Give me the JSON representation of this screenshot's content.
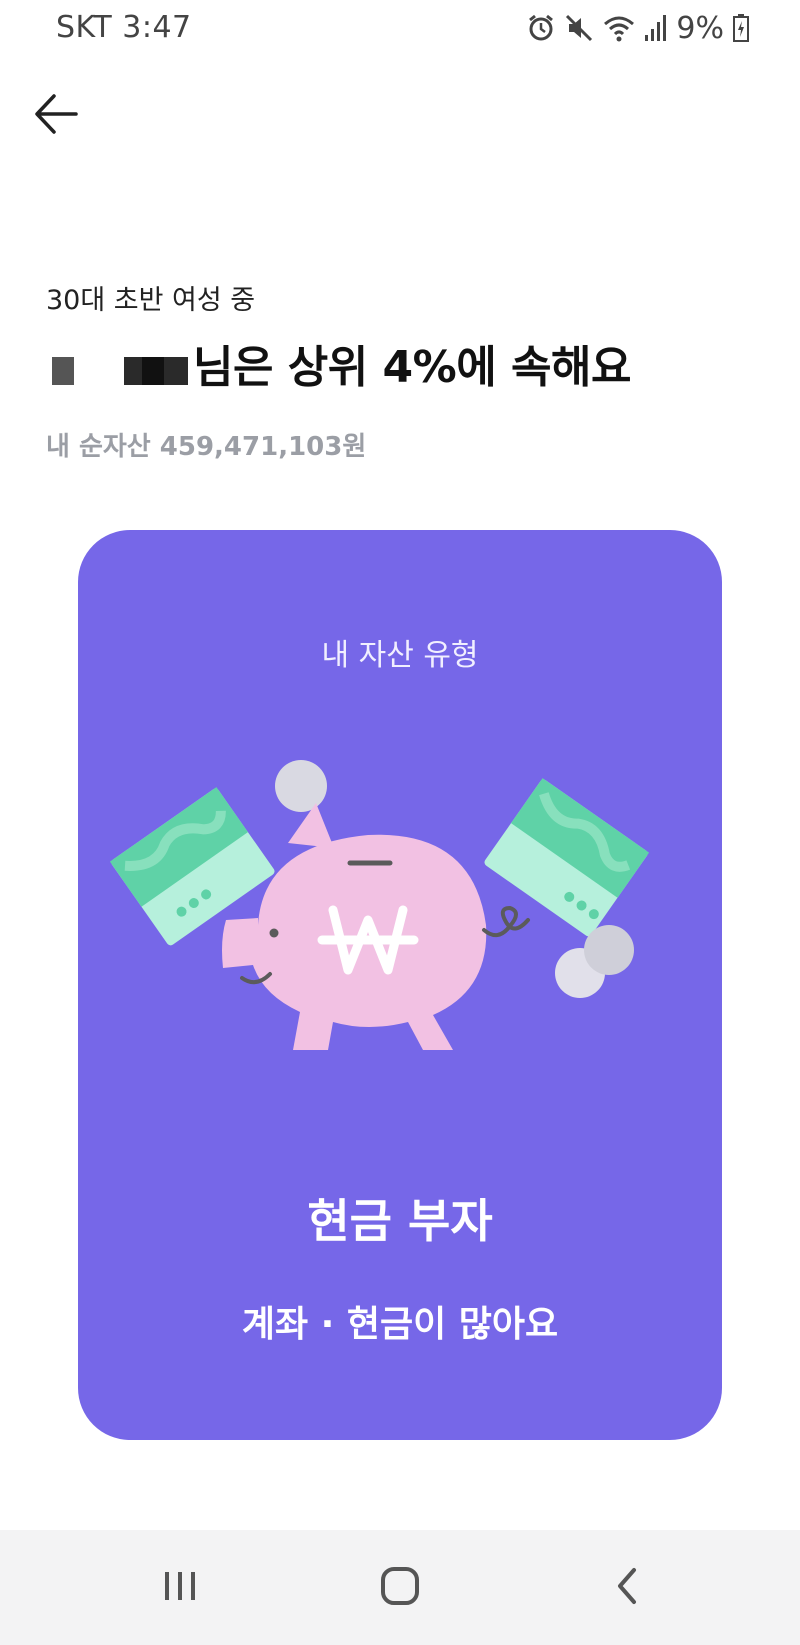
{
  "status_bar": {
    "carrier_time": "SKT 3:47",
    "battery_percent": "9%",
    "icons": [
      "alarm-icon",
      "mute-icon",
      "wifi-icon",
      "signal-icon",
      "battery-icon"
    ]
  },
  "header": {
    "back_icon": "back-arrow-icon"
  },
  "summary": {
    "subtitle": "30대 초반 여성 중",
    "headline": "님은 상위 4%에 속해요",
    "net_asset": "내 순자산 459,471,103원"
  },
  "card": {
    "label": "내 자산 유형",
    "title": "현금 부자",
    "description": "계좌 · 현금이 많아요",
    "background_color": "#7667e8"
  },
  "nav": {
    "icons": [
      "recent-apps-icon",
      "home-icon",
      "back-icon"
    ]
  }
}
